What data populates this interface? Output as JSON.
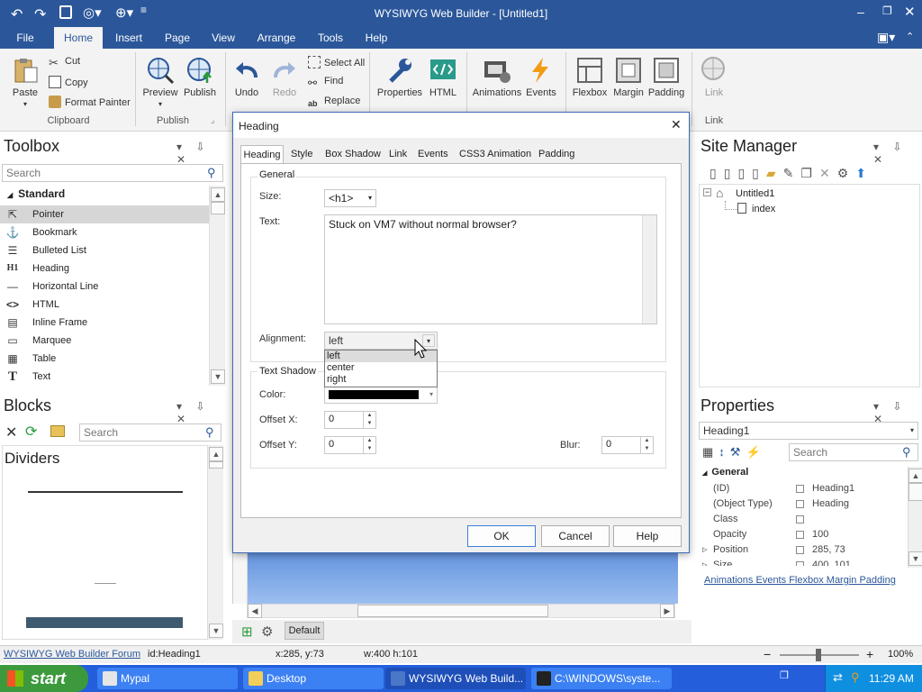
{
  "window": {
    "title": "WYSIWYG Web Builder - [Untitled1]"
  },
  "menu": [
    "File",
    "Home",
    "Insert",
    "Page",
    "View",
    "Arrange",
    "Tools",
    "Help"
  ],
  "ribbon": {
    "paste": "Paste",
    "cut": "Cut",
    "copy": "Copy",
    "format_painter": "Format Painter",
    "clipboard_group": "Clipboard",
    "preview": "Preview",
    "publish": "Publish",
    "publish_group": "Publish",
    "undo": "Undo",
    "redo": "Redo",
    "select_all": "Select All",
    "find": "Find",
    "replace": "Replace",
    "properties": "Properties",
    "html": "HTML",
    "animations": "Animations",
    "events": "Events",
    "flexbox": "Flexbox",
    "margin": "Margin",
    "padding": "Padding",
    "link": "Link",
    "link_group": "Link"
  },
  "toolbox": {
    "title": "Toolbox",
    "search_placeholder": "Search",
    "category": "Standard",
    "items": [
      "Pointer",
      "Bookmark",
      "Bulleted List",
      "Heading",
      "Horizontal Line",
      "HTML",
      "Inline Frame",
      "Marquee",
      "Table",
      "Text"
    ]
  },
  "blocks": {
    "title": "Blocks",
    "search_placeholder": "Search",
    "category": "Dividers"
  },
  "dialog": {
    "title": "Heading",
    "tabs": [
      "Heading",
      "Style",
      "Box Shadow",
      "Link",
      "Events",
      "CSS3 Animation",
      "Padding"
    ],
    "general_label": "General",
    "size_label": "Size:",
    "size_value": "<h1>",
    "text_label": "Text:",
    "text_value": "Stuck on VM7 without normal browser?",
    "alignment_label": "Alignment:",
    "alignment_value": "left",
    "alignment_options": [
      "left",
      "center",
      "right"
    ],
    "text_shadow_label": "Text Shadow",
    "color_label": "Color:",
    "offset_x_label": "Offset X:",
    "offset_x_value": "0",
    "offset_y_label": "Offset Y:",
    "offset_y_value": "0",
    "blur_label": "Blur:",
    "blur_value": "0",
    "ok": "OK",
    "cancel": "Cancel",
    "help": "Help"
  },
  "site_manager": {
    "title": "Site Manager",
    "root": "Untitled1",
    "page": "index"
  },
  "properties": {
    "title": "Properties",
    "object": "Heading1",
    "search_placeholder": "Search",
    "group": "General",
    "rows": [
      {
        "key": "(ID)",
        "value": "Heading1"
      },
      {
        "key": "(Object Type)",
        "value": "Heading"
      },
      {
        "key": "Class",
        "value": ""
      },
      {
        "key": "Opacity",
        "value": "100"
      },
      {
        "key": "Position",
        "value": "285, 73"
      },
      {
        "key": "Size",
        "value": "400, 101"
      }
    ],
    "links": [
      "Animations",
      "Events",
      "Flexbox",
      "Margin",
      "Padding"
    ]
  },
  "canvas": {
    "page_tab": "Default"
  },
  "status": {
    "forum": "WYSIWYG Web Builder Forum",
    "id": "id:Heading1",
    "pos": "x:285, y:73",
    "size": "w:400 h:101",
    "zoom": "100%"
  },
  "taskbar": {
    "start": "start",
    "tasks": [
      "Mypal",
      "Desktop",
      "WYSIWYG Web Build...",
      "C:\\WINDOWS\\syste..."
    ],
    "clock": "11:29 AM"
  }
}
